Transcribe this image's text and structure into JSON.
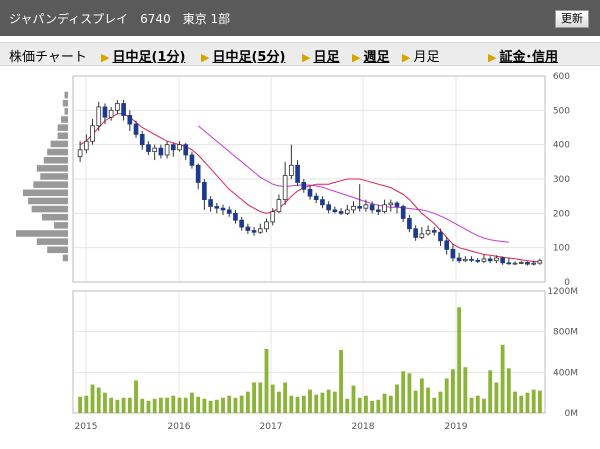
{
  "header": {
    "title": "ジャパンディスプレイ　6740　東京 1部",
    "update_label": "更新"
  },
  "nav": {
    "label": "株価チャート",
    "items": [
      {
        "label": "日中足(1分)",
        "link": true
      },
      {
        "label": "日中足(5分)",
        "link": true
      },
      {
        "label": "日足",
        "link": true
      },
      {
        "label": "週足",
        "link": true
      },
      {
        "label": "月足",
        "link": false
      },
      {
        "label": "証金･信用",
        "link": true
      }
    ]
  },
  "colors": {
    "up_candle": "#ffffff",
    "down_candle": "#1c3b8c",
    "ma_short": "#e0224e",
    "ma_long": "#c23ad6",
    "volume_bar": "#8db43a",
    "profile_bar": "#999999",
    "grid": "#e4e4e4"
  },
  "chart_data": [
    {
      "type": "candlestick",
      "x_tick_labels": [
        "2015",
        "2016",
        "2017",
        "2018",
        "2019"
      ],
      "y_tick_labels": [
        "0",
        "100",
        "200",
        "300",
        "400",
        "500",
        "600"
      ],
      "ylim": [
        0,
        600
      ],
      "candles": [
        [
          365,
          385,
          410,
          350
        ],
        [
          385,
          410,
          430,
          375
        ],
        [
          410,
          455,
          475,
          400
        ],
        [
          455,
          510,
          525,
          440
        ],
        [
          510,
          480,
          520,
          460
        ],
        [
          480,
          500,
          510,
          470
        ],
        [
          500,
          520,
          530,
          490
        ],
        [
          520,
          485,
          530,
          470
        ],
        [
          485,
          460,
          500,
          440
        ],
        [
          460,
          430,
          470,
          420
        ],
        [
          430,
          400,
          440,
          385
        ],
        [
          400,
          380,
          410,
          370
        ],
        [
          380,
          390,
          400,
          355
        ],
        [
          390,
          370,
          400,
          360
        ],
        [
          370,
          400,
          410,
          360
        ],
        [
          400,
          385,
          405,
          365
        ],
        [
          385,
          400,
          410,
          380
        ],
        [
          400,
          370,
          405,
          355
        ],
        [
          370,
          340,
          380,
          330
        ],
        [
          340,
          290,
          345,
          270
        ],
        [
          290,
          240,
          300,
          210
        ],
        [
          240,
          220,
          250,
          205
        ],
        [
          220,
          215,
          230,
          200
        ],
        [
          215,
          210,
          225,
          195
        ],
        [
          210,
          200,
          220,
          190
        ],
        [
          200,
          180,
          210,
          170
        ],
        [
          180,
          160,
          190,
          150
        ],
        [
          160,
          150,
          170,
          140
        ],
        [
          150,
          145,
          160,
          135
        ],
        [
          145,
          155,
          170,
          140
        ],
        [
          155,
          175,
          185,
          145
        ],
        [
          175,
          205,
          215,
          165
        ],
        [
          205,
          240,
          255,
          200
        ],
        [
          240,
          310,
          350,
          225
        ],
        [
          310,
          340,
          400,
          300
        ],
        [
          340,
          290,
          355,
          280
        ],
        [
          290,
          270,
          300,
          260
        ],
        [
          270,
          250,
          280,
          240
        ],
        [
          250,
          240,
          260,
          230
        ],
        [
          240,
          225,
          250,
          215
        ],
        [
          225,
          210,
          235,
          200
        ],
        [
          210,
          205,
          220,
          200
        ],
        [
          205,
          200,
          215,
          195
        ],
        [
          200,
          210,
          225,
          195
        ],
        [
          210,
          220,
          235,
          200
        ],
        [
          220,
          215,
          285,
          205
        ],
        [
          215,
          225,
          240,
          205
        ],
        [
          225,
          210,
          235,
          200
        ],
        [
          210,
          205,
          225,
          195
        ],
        [
          205,
          225,
          240,
          200
        ],
        [
          225,
          230,
          240,
          205
        ],
        [
          230,
          220,
          235,
          200
        ],
        [
          220,
          185,
          225,
          175
        ],
        [
          185,
          155,
          195,
          145
        ],
        [
          155,
          130,
          165,
          120
        ],
        [
          130,
          140,
          160,
          125
        ],
        [
          140,
          150,
          165,
          135
        ],
        [
          150,
          145,
          160,
          135
        ],
        [
          145,
          120,
          155,
          105
        ],
        [
          120,
          95,
          130,
          80
        ],
        [
          95,
          70,
          110,
          60
        ],
        [
          70,
          62,
          85,
          55
        ],
        [
          62,
          66,
          75,
          58
        ],
        [
          66,
          63,
          75,
          58
        ],
        [
          63,
          60,
          70,
          55
        ],
        [
          60,
          67,
          80,
          55
        ],
        [
          67,
          62,
          75,
          55
        ],
        [
          62,
          70,
          78,
          55
        ],
        [
          70,
          56,
          75,
          50
        ],
        [
          56,
          54,
          70,
          50
        ],
        [
          54,
          55,
          60,
          50
        ],
        [
          55,
          57,
          62,
          52
        ],
        [
          57,
          52,
          60,
          48
        ],
        [
          52,
          55,
          62,
          48
        ],
        [
          55,
          62,
          68,
          50
        ]
      ],
      "ma_short": [
        400,
        410,
        430,
        450,
        470,
        480,
        490,
        490,
        480,
        465,
        450,
        440,
        430,
        420,
        410,
        405,
        400,
        395,
        385,
        370,
        350,
        330,
        310,
        290,
        270,
        255,
        240,
        225,
        215,
        205,
        200,
        205,
        215,
        230,
        250,
        265,
        275,
        280,
        285,
        285,
        285,
        290,
        295,
        300,
        300,
        300,
        295,
        290,
        285,
        280,
        275,
        265,
        255,
        240,
        220,
        200,
        185,
        170,
        150,
        130,
        110,
        100,
        95,
        90,
        85,
        80,
        78,
        75,
        72,
        70,
        68,
        65,
        62,
        60,
        58
      ],
      "ma_long_start": 19,
      "ma_long": [
        455,
        440,
        425,
        410,
        395,
        380,
        365,
        350,
        335,
        320,
        305,
        295,
        285,
        280,
        278,
        280,
        282,
        283,
        282,
        280,
        276,
        270,
        264,
        258,
        252,
        246,
        240,
        234,
        228,
        224,
        220,
        218,
        218,
        216,
        214,
        212,
        210,
        206,
        200,
        192,
        184,
        174,
        164,
        154,
        144,
        135,
        128,
        123,
        120,
        118,
        116
      ]
    },
    {
      "type": "bar",
      "y_tick_labels": [
        "0M",
        "400M",
        "800M",
        "1200M"
      ],
      "ylim": [
        0,
        1200
      ],
      "values": [
        160,
        170,
        280,
        250,
        200,
        150,
        130,
        150,
        150,
        320,
        140,
        120,
        140,
        150,
        150,
        170,
        150,
        150,
        200,
        160,
        140,
        120,
        130,
        150,
        170,
        150,
        170,
        210,
        300,
        300,
        630,
        280,
        210,
        300,
        170,
        160,
        170,
        230,
        180,
        200,
        230,
        210,
        620,
        140,
        270,
        150,
        170,
        120,
        130,
        190,
        170,
        280,
        410,
        390,
        220,
        340,
        250,
        150,
        210,
        340,
        430,
        1040,
        450,
        150,
        170,
        140,
        420,
        300,
        670,
        440,
        210,
        170,
        200,
        230,
        220
      ]
    },
    {
      "type": "bar",
      "note": "price-by-volume profile",
      "values": [
        30,
        120,
        180,
        300,
        80,
        150,
        210,
        230,
        260,
        200,
        160,
        180,
        140,
        120,
        100,
        60,
        60,
        40,
        20,
        30,
        20
      ]
    }
  ]
}
